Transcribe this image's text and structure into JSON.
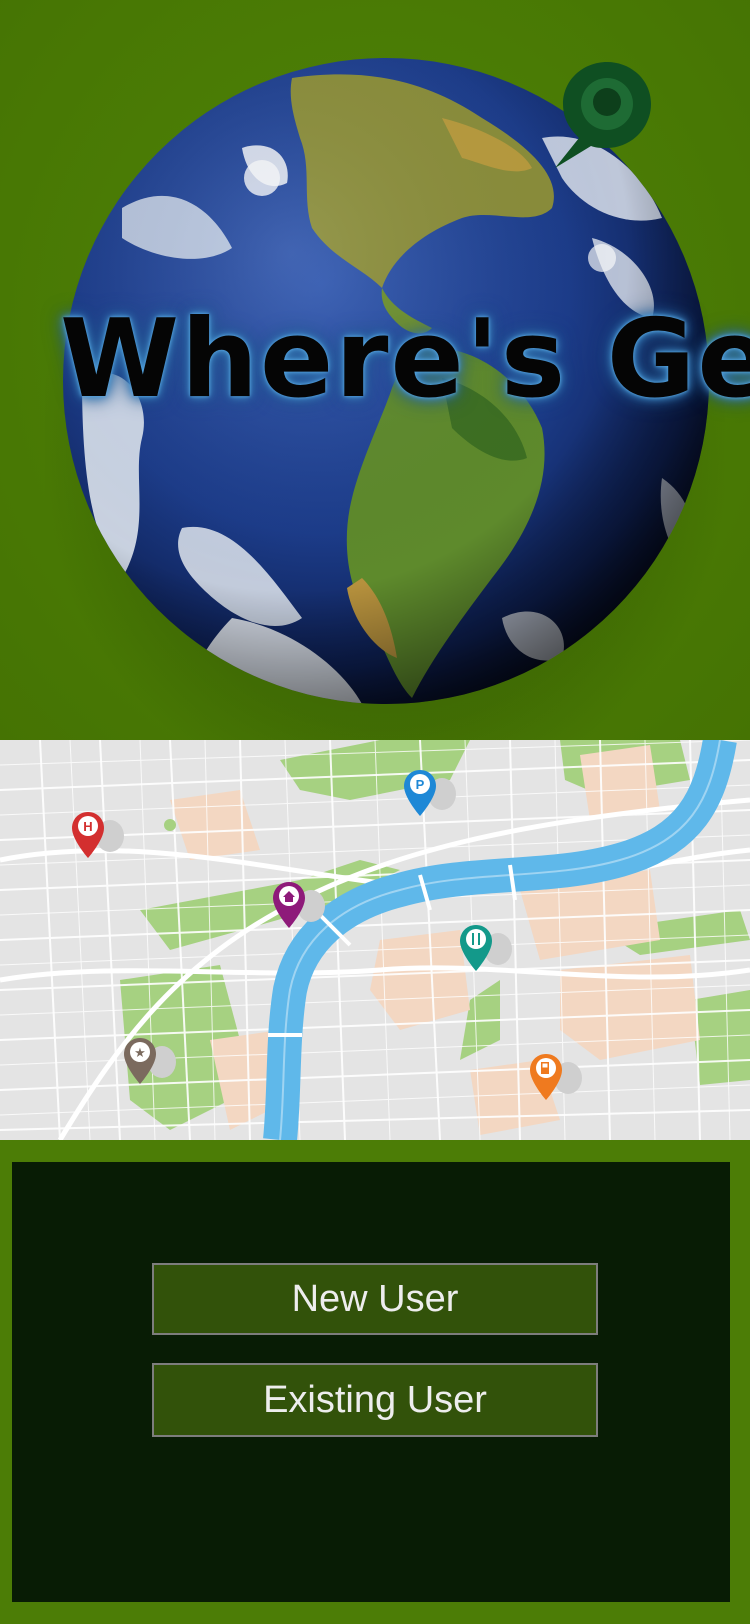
{
  "app": {
    "logo_text": "Where's Geo"
  },
  "map_pins": [
    {
      "icon": "hospital-pin-icon",
      "glyph": "H",
      "color": "#d32f2f"
    },
    {
      "icon": "parking-pin-icon",
      "glyph": "P",
      "color": "#1e88d6"
    },
    {
      "icon": "home-pin-icon",
      "glyph": "⌂",
      "color": "#8e1a7a"
    },
    {
      "icon": "restaurant-pin-icon",
      "glyph": "ǁ",
      "color": "#13998a"
    },
    {
      "icon": "attraction-pin-icon",
      "glyph": "★",
      "color": "#7b6a5e"
    },
    {
      "icon": "fuel-pin-icon",
      "glyph": "⛽",
      "color": "#ef7a1f"
    }
  ],
  "actions": {
    "new_user_label": "New User",
    "existing_user_label": "Existing User"
  },
  "colors": {
    "background": "#4c7d06",
    "panel": "#081c05",
    "button": "#32520a",
    "button_border": "#7d7d7d",
    "river": "#5fb8ea",
    "park": "#a3d07e"
  }
}
